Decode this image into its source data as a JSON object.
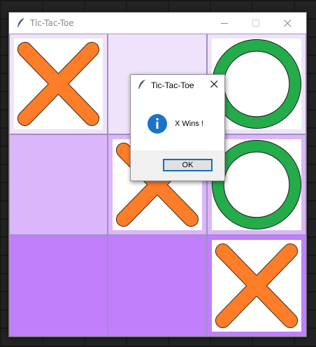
{
  "window": {
    "title": "Tic-Tac-Toe"
  },
  "colors": {
    "cell_light": "#efe2fb",
    "cell_medium": "#dbb6fa",
    "cell_dark": "#c17ffb",
    "x_mark": "#fd7d28",
    "o_mark": "#23ac49",
    "info_blue": "#1a73c8"
  },
  "board": {
    "cells": [
      {
        "position": "top-left",
        "mark": "X",
        "shade": "light"
      },
      {
        "position": "top-middle",
        "mark": "",
        "shade": "light"
      },
      {
        "position": "top-right",
        "mark": "O",
        "shade": "light"
      },
      {
        "position": "middle-left",
        "mark": "",
        "shade": "medium"
      },
      {
        "position": "center",
        "mark": "X",
        "shade": "medium"
      },
      {
        "position": "middle-right",
        "mark": "O",
        "shade": "medium"
      },
      {
        "position": "bottom-left",
        "mark": "",
        "shade": "dark"
      },
      {
        "position": "bottom-middle",
        "mark": "",
        "shade": "dark"
      },
      {
        "position": "bottom-right",
        "mark": "X",
        "shade": "dark"
      }
    ]
  },
  "dialog": {
    "title": "Tic-Tac-Toe",
    "message": "X Wins !",
    "ok_label": "OK",
    "icon": "info-icon"
  }
}
